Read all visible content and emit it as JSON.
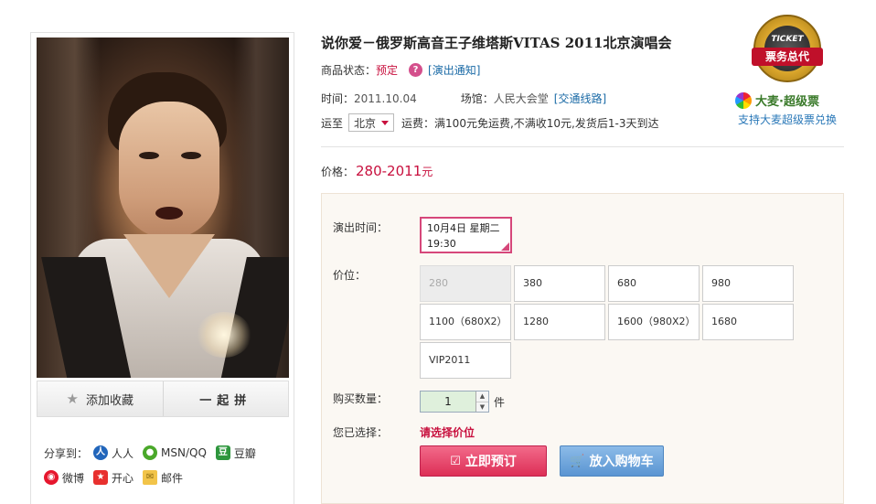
{
  "left": {
    "actions": {
      "favorite": "添加收藏",
      "together": "一起拼"
    },
    "share": {
      "label": "分享到：",
      "items": [
        {
          "icon": "renren-icon",
          "label": "人人"
        },
        {
          "icon": "msn-qq-icon",
          "label": "MSN/QQ"
        },
        {
          "icon": "douban-icon",
          "label": "豆瓣"
        },
        {
          "icon": "weibo-icon",
          "label": "微博"
        },
        {
          "icon": "kaixin-icon",
          "label": "开心"
        },
        {
          "icon": "mail-icon",
          "label": "邮件"
        }
      ]
    }
  },
  "product": {
    "title": "说你爱－俄罗斯高音王子维塔斯VITAS 2011北京演唱会",
    "status_label": "商品状态：",
    "status_value": "预定",
    "notice_link": "[演出通知]",
    "time_label": "时间：",
    "time_value": "2011.10.04",
    "venue_label": "场馆：",
    "venue_value": "人民大会堂",
    "route_link": "[交通线路]",
    "ship_label": "运至",
    "ship_city": "北京",
    "fee_label": "运费：",
    "fee_value": "满100元免运费,不满收10元,发货后1-3天到达",
    "price_label": "价格：",
    "price_value": "280-2011",
    "price_unit": "元"
  },
  "badge": {
    "ticket": "TICKET",
    "ribbon": "票务总代",
    "damai": "大麦·超级票",
    "damai_sub": "支持大麦超级票兑换"
  },
  "purchase": {
    "show_time_label": "演出时间：",
    "show_time_line1": "10月4日 星期二",
    "show_time_line2": "19:30",
    "price_label": "价位：",
    "options": [
      {
        "label": "280",
        "disabled": true
      },
      {
        "label": "380",
        "disabled": false
      },
      {
        "label": "680",
        "disabled": false
      },
      {
        "label": "980",
        "disabled": false
      },
      {
        "label": "1100（680X2）",
        "disabled": false
      },
      {
        "label": "1280",
        "disabled": false
      },
      {
        "label": "1600（980X2）",
        "disabled": false
      },
      {
        "label": "1680",
        "disabled": false
      },
      {
        "label": "VIP2011",
        "disabled": false
      }
    ],
    "qty_label": "购买数量：",
    "qty_value": "1",
    "qty_unit": "件",
    "chosen_label": "您已选择：",
    "chosen_value": "请选择价位",
    "order_button": "立即预订",
    "cart_button": "放入购物车"
  },
  "colors": {
    "accent": "#c8103e",
    "link": "#1a6aa6",
    "selected_border": "#d6477a",
    "cart_blue": "#5a95d2"
  }
}
